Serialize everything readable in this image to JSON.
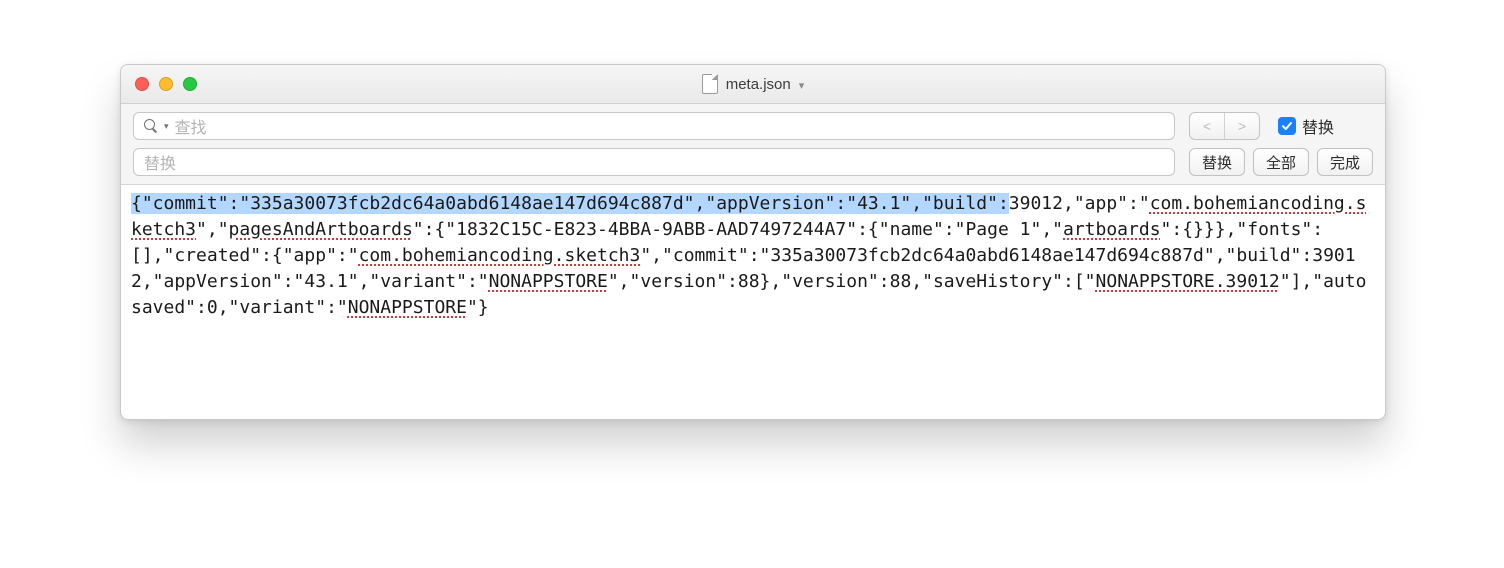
{
  "titlebar": {
    "filename": "meta.json"
  },
  "findbar": {
    "search_placeholder": "查找",
    "replace_placeholder": "替换",
    "toggle_label": "替换",
    "btn_replace": "替换",
    "btn_all": "全部",
    "btn_done": "完成",
    "nav_prev": "<",
    "nav_next": ">"
  },
  "editor": {
    "seg_hl": "{\"commit\":\"335a30073fcb2dc64a0abd6148ae147d694c887d\",\"appVersion\":\"43.1\",\"build\":",
    "seg1": "39012,\"app\":\"",
    "sp1": "com.bohemiancoding.sketch3",
    "seg2": "\",\"",
    "sp2": "pagesAndArtboards",
    "seg3": "\":{\"1832C15C-E823-4BBA-9ABB-AAD7497244A7\":{\"name\":\"Page 1\",\"",
    "sp3": "artboards",
    "seg4": "\":{}}},\"fonts\":[],\"created\":{\"app\":\"",
    "sp4": "com.bohemiancoding.sketch3",
    "seg5": "\",\"commit\":\"335a30073fcb2dc64a0abd6148ae147d694c887d\",\"build\":39012,\"appVersion\":\"43.1\",\"variant\":\"",
    "sp5": "NONAPPSTORE",
    "seg6": "\",\"version\":88},\"version\":88,\"saveHistory\":[\"",
    "sp6": "NONAPPSTORE.39012",
    "seg7": "\"],\"autosaved\":0,\"variant\":\"",
    "sp7": "NONAPPSTORE",
    "seg8": "\"}"
  }
}
